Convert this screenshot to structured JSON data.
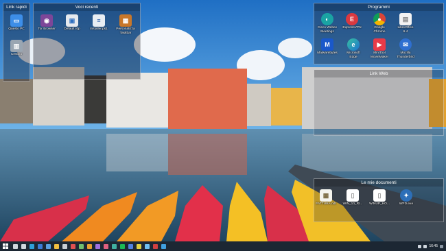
{
  "fences": {
    "link_rapidi": {
      "title": "Link rapidi",
      "items": [
        {
          "label": "Questo PC",
          "icon": "computer-icon"
        },
        {
          "label": "Cestino",
          "icon": "recycle-bin-icon"
        }
      ]
    },
    "voci_recenti": {
      "title": "Voci recenti",
      "items": [
        {
          "label": "Tor Browser",
          "icon": "tor-browser-icon"
        },
        {
          "label": "Default.rdp",
          "icon": "remote-desktop-icon"
        },
        {
          "label": "Installer.ps1",
          "icon": "powershell-script-icon"
        },
        {
          "label": "Personalizza Taskbar",
          "icon": "taskbar-customize-icon"
        }
      ]
    },
    "programmi": {
      "title": "Programmi",
      "items": [
        {
          "label": "Cisco Webex Meetings",
          "icon": "webex-icon"
        },
        {
          "label": "ExpressVPN",
          "icon": "expressvpn-icon"
        },
        {
          "label": "Google Chrome",
          "icon": "chrome-icon"
        },
        {
          "label": "LibreOffice 6.4",
          "icon": "libreoffice-icon"
        },
        {
          "label": "Malwarebytes",
          "icon": "malwarebytes-icon"
        },
        {
          "label": "Microsoft Edge",
          "icon": "edge-icon"
        },
        {
          "label": "MiniTool MovieMaker",
          "icon": "minitool-icon"
        },
        {
          "label": "Mozilla Thunderbird",
          "icon": "thunderbird-icon"
        }
      ]
    },
    "link_web": {
      "title": "Link Web",
      "items": []
    },
    "documenti": {
      "title": "Le mie documenti",
      "items": [
        {
          "label": "FATTURA.odt",
          "icon": "spreadsheet-file-icon"
        },
        {
          "label": "WIN_10_RI...",
          "icon": "document-file-icon"
        },
        {
          "label": "WINUP_HO...",
          "icon": "document-file-icon"
        },
        {
          "label": "WPD.exe",
          "icon": "wpd-app-icon"
        }
      ]
    }
  },
  "taskbar": {
    "start_icon": "windows-start-icon",
    "pinned": [
      {
        "name": "search-icon",
        "color": "#d0d6dd"
      },
      {
        "name": "task-view-icon",
        "color": "#d0d6dd"
      },
      {
        "name": "edge-icon",
        "color": "#2f9fd8"
      },
      {
        "name": "store-icon",
        "color": "#3a7bd5"
      },
      {
        "name": "mail-icon",
        "color": "#5aa0e0"
      },
      {
        "name": "explorer-icon",
        "color": "#f0c040"
      },
      {
        "name": "settings-icon",
        "color": "#c8cdd3"
      },
      {
        "name": "app-icon",
        "color": "#e05050"
      },
      {
        "name": "app-icon",
        "color": "#6fc06f"
      },
      {
        "name": "app-icon",
        "color": "#e8a030"
      },
      {
        "name": "app-icon",
        "color": "#a070e0"
      },
      {
        "name": "app-icon",
        "color": "#e06080"
      },
      {
        "name": "app-icon",
        "color": "#40b0a0"
      },
      {
        "name": "spotify-icon",
        "color": "#1db954"
      },
      {
        "name": "app-icon",
        "color": "#5080e0"
      },
      {
        "name": "app-icon",
        "color": "#e0d040"
      },
      {
        "name": "app-icon",
        "color": "#70c0f0"
      },
      {
        "name": "app-icon",
        "color": "#d04040"
      },
      {
        "name": "app-icon",
        "color": "#40a0e0"
      }
    ],
    "clock": "16:45"
  }
}
